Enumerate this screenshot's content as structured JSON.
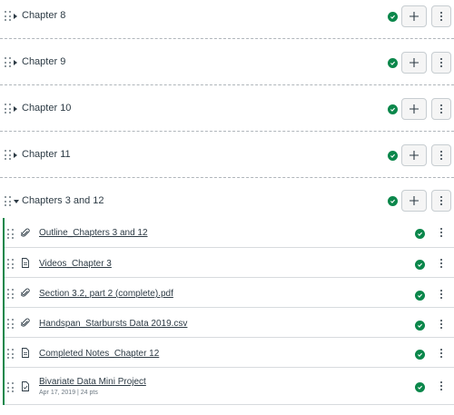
{
  "modules": [
    {
      "title": "Chapter 8",
      "expanded": false
    },
    {
      "title": "Chapter 9",
      "expanded": false
    },
    {
      "title": "Chapter 10",
      "expanded": false
    },
    {
      "title": "Chapter 11",
      "expanded": false
    },
    {
      "title": "Chapters 3 and 12",
      "expanded": true
    }
  ],
  "items": [
    {
      "title": "Outline_Chapters 3 and 12",
      "icon": "attachment-icon"
    },
    {
      "title": "Videos_Chapter 3",
      "icon": "page-icon"
    },
    {
      "title": "Section 3.2, part 2 (complete).pdf",
      "icon": "attachment-icon"
    },
    {
      "title": "Handspan_Starbursts Data 2019.csv",
      "icon": "attachment-icon"
    },
    {
      "title": "Completed Notes_Chapter 12",
      "icon": "page-icon"
    },
    {
      "title": "Bivariate Data Mini Project",
      "icon": "assignment-icon",
      "meta": "Apr 17, 2019  |  24 pts"
    }
  ],
  "colors": {
    "accent": "#0b874b",
    "text": "#2d3b45",
    "muted": "#6b7780"
  }
}
